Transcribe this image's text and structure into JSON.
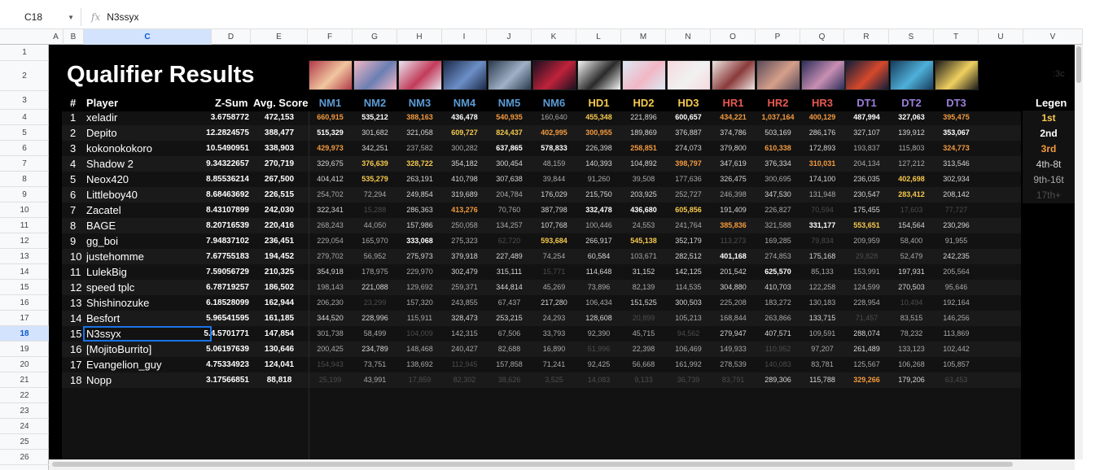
{
  "formula_bar": {
    "cell_ref": "C18",
    "fx": "fx",
    "value": "N3ssyx"
  },
  "col_headers": [
    "A",
    "B",
    "C",
    "D",
    "E",
    "F",
    "G",
    "H",
    "I",
    "J",
    "K",
    "L",
    "M",
    "N",
    "O",
    "P",
    "Q",
    "R",
    "S",
    "T",
    "U",
    "V"
  ],
  "row_numbers": [
    "1",
    "2",
    "3",
    "4",
    "5",
    "6",
    "7",
    "8",
    "9",
    "10",
    "11",
    "12",
    "13",
    "14",
    "15",
    "16",
    "17",
    "18",
    "19",
    "20",
    "21",
    "22",
    "23",
    "24",
    "25",
    "26"
  ],
  "sheet": {
    "title": "Qualifier Results",
    "rank_header": "#",
    "player_header": "Player",
    "zsum_header": "Z-Sum",
    "avg_header": "Avg. Score",
    "faded_text": ":3c",
    "legend_header": "Legen",
    "legend": [
      {
        "label": "1st",
        "color": "#f6c94e"
      },
      {
        "label": "2nd",
        "color": "#ffffff"
      },
      {
        "label": "3rd",
        "color": "#f49a3e"
      },
      {
        "label": "4th-8t",
        "color": "#d6d6d6"
      },
      {
        "label": "9th-16t",
        "color": "#a9a9a9"
      },
      {
        "label": "17th+",
        "color": "#4d4d4d"
      }
    ],
    "maps": [
      {
        "name": "NM1",
        "color": "#5b9bd5"
      },
      {
        "name": "NM2",
        "color": "#5b9bd5"
      },
      {
        "name": "NM3",
        "color": "#5b9bd5"
      },
      {
        "name": "NM4",
        "color": "#5b9bd5"
      },
      {
        "name": "NM5",
        "color": "#5b9bd5"
      },
      {
        "name": "NM6",
        "color": "#5b9bd5"
      },
      {
        "name": "HD1",
        "color": "#f6c94e"
      },
      {
        "name": "HD2",
        "color": "#f6c94e"
      },
      {
        "name": "HD3",
        "color": "#f6c94e"
      },
      {
        "name": "HR1",
        "color": "#e8584e"
      },
      {
        "name": "HR2",
        "color": "#e8584e"
      },
      {
        "name": "HR3",
        "color": "#e8584e"
      },
      {
        "name": "DT1",
        "color": "#9b7fd9"
      },
      {
        "name": "DT2",
        "color": "#9b7fd9"
      },
      {
        "name": "DT3",
        "color": "#9b7fd9"
      }
    ],
    "banner_colors": [
      [
        "#b23a48",
        "#f1c6a0"
      ],
      [
        "#f2b6c6",
        "#6b7fb3"
      ],
      [
        "#e9e4ef",
        "#c23b5a"
      ],
      [
        "#1d2a4a",
        "#6c8fc7"
      ],
      [
        "#2b3a4e",
        "#9fb1c6"
      ],
      [
        "#1a0f1f",
        "#c0223b"
      ],
      [
        "#f5f5f5",
        "#2a2a2a"
      ],
      [
        "#dbe9f5",
        "#f2b7c5"
      ],
      [
        "#f6d9de",
        "#f1f1f1"
      ],
      [
        "#efe6e2",
        "#8a3b3b"
      ],
      [
        "#5a4a5a",
        "#d6a08a"
      ],
      [
        "#2b2e5a",
        "#c98fb3"
      ],
      [
        "#0e1d3a",
        "#d6482c"
      ],
      [
        "#163b5c",
        "#4fb0d9"
      ],
      [
        "#1a1a1a",
        "#f0d060"
      ]
    ],
    "players": [
      {
        "rank": "1",
        "name": "xeladir",
        "zsum": "3.6758772",
        "avg": "472,153",
        "scores": [
          "660,915",
          "535,212",
          "388,163",
          "436,478",
          "540,935",
          "160,640",
          "455,348",
          "221,896",
          "600,657",
          "434,221",
          "1,037,164",
          "400,129",
          "487,994",
          "327,063",
          "395,475"
        ],
        "tiers": [
          3,
          2,
          3,
          2,
          3,
          5,
          1,
          4,
          2,
          3,
          3,
          3,
          2,
          2,
          3
        ]
      },
      {
        "rank": "2",
        "name": "Depito",
        "zsum": "12.2824575",
        "avg": "388,477",
        "scores": [
          "515,329",
          "301,682",
          "321,058",
          "609,727",
          "824,437",
          "402,995",
          "300,955",
          "189,869",
          "376,887",
          "374,786",
          "503,169",
          "286,176",
          "327,107",
          "139,912",
          "353,067"
        ],
        "tiers": [
          2,
          4,
          4,
          1,
          1,
          3,
          3,
          4,
          4,
          4,
          4,
          4,
          4,
          4,
          2
        ]
      },
      {
        "rank": "3",
        "name": "kokonokokoro",
        "zsum": "10.5490951",
        "avg": "338,903",
        "scores": [
          "429,973",
          "342,251",
          "237,582",
          "300,282",
          "637,865",
          "578,833",
          "226,398",
          "258,851",
          "274,073",
          "379,800",
          "610,338",
          "172,893",
          "193,837",
          "115,803",
          "324,773"
        ],
        "tiers": [
          3,
          4,
          5,
          5,
          2,
          2,
          4,
          3,
          4,
          4,
          3,
          4,
          5,
          5,
          3
        ]
      },
      {
        "rank": "4",
        "name": "Shadow 2",
        "zsum": "9.34322657",
        "avg": "270,719",
        "scores": [
          "329,675",
          "376,639",
          "328,722",
          "354,182",
          "300,454",
          "48,159",
          "140,393",
          "104,892",
          "398,797",
          "347,619",
          "376,334",
          "310,031",
          "204,134",
          "127,212",
          "313,546"
        ],
        "tiers": [
          4,
          1,
          1,
          4,
          4,
          5,
          4,
          4,
          3,
          4,
          4,
          3,
          5,
          5,
          4
        ]
      },
      {
        "rank": "5",
        "name": "Neox420",
        "zsum": "8.85536214",
        "avg": "267,500",
        "scores": [
          "404,412",
          "535,279",
          "263,191",
          "410,798",
          "307,638",
          "39,844",
          "91,260",
          "39,508",
          "177,636",
          "326,475",
          "300,695",
          "174,100",
          "236,035",
          "402,698",
          "302,934"
        ],
        "tiers": [
          4,
          1,
          4,
          4,
          4,
          5,
          5,
          5,
          5,
          4,
          5,
          4,
          4,
          1,
          4
        ]
      },
      {
        "rank": "6",
        "name": "Littleboy40",
        "zsum": "8.68463692",
        "avg": "226,515",
        "scores": [
          "254,702",
          "72,294",
          "249,854",
          "319,689",
          "204,784",
          "176,029",
          "215,750",
          "203,925",
          "252,727",
          "246,398",
          "347,530",
          "131,948",
          "230,547",
          "283,412",
          "208,142"
        ],
        "tiers": [
          5,
          5,
          4,
          4,
          5,
          4,
          4,
          4,
          5,
          5,
          4,
          5,
          4,
          1,
          4
        ]
      },
      {
        "rank": "7",
        "name": "Zacatel",
        "zsum": "8.43107899",
        "avg": "242,030",
        "scores": [
          "322,341",
          "15,288",
          "286,363",
          "413,276",
          "70,760",
          "387,798",
          "332,478",
          "436,680",
          "605,856",
          "191,409",
          "226,827",
          "70,594",
          "175,455",
          "17,603",
          "77,727"
        ],
        "tiers": [
          4,
          6,
          4,
          3,
          5,
          4,
          2,
          2,
          1,
          4,
          5,
          6,
          4,
          6,
          6
        ]
      },
      {
        "rank": "8",
        "name": "BAGE",
        "zsum": "8.20716539",
        "avg": "220,416",
        "scores": [
          "268,243",
          "44,050",
          "157,986",
          "250,058",
          "134,257",
          "107,768",
          "100,446",
          "24,553",
          "241,764",
          "385,836",
          "321,588",
          "331,177",
          "553,651",
          "154,564",
          "230,296"
        ],
        "tiers": [
          5,
          5,
          4,
          5,
          5,
          4,
          5,
          5,
          5,
          3,
          5,
          2,
          1,
          4,
          4
        ]
      },
      {
        "rank": "9",
        "name": "gg_boi",
        "zsum": "7.94837102",
        "avg": "236,451",
        "scores": [
          "229,054",
          "165,970",
          "333,068",
          "275,323",
          "62,720",
          "593,684",
          "266,917",
          "545,138",
          "352,179",
          "113,273",
          "169,285",
          "79,834",
          "209,959",
          "58,400",
          "91,955"
        ],
        "tiers": [
          5,
          5,
          2,
          5,
          6,
          1,
          4,
          1,
          4,
          6,
          5,
          6,
          5,
          5,
          5
        ]
      },
      {
        "rank": "10",
        "name": "justehomme",
        "zsum": "7.67755183",
        "avg": "194,452",
        "scores": [
          "279,702",
          "56,952",
          "275,973",
          "379,918",
          "227,489",
          "74,254",
          "60,584",
          "103,671",
          "282,512",
          "401,168",
          "274,853",
          "175,168",
          "29,828",
          "52,479",
          "242,235"
        ],
        "tiers": [
          5,
          5,
          4,
          4,
          4,
          5,
          4,
          5,
          4,
          2,
          5,
          4,
          6,
          5,
          4
        ]
      },
      {
        "rank": "11",
        "name": "LulekBig",
        "zsum": "7.59056729",
        "avg": "210,325",
        "scores": [
          "354,918",
          "178,975",
          "229,970",
          "302,479",
          "315,111",
          "15,771",
          "114,648",
          "31,152",
          "142,125",
          "201,542",
          "625,570",
          "85,133",
          "153,991",
          "197,931",
          "205,564"
        ],
        "tiers": [
          4,
          5,
          5,
          4,
          4,
          6,
          4,
          4,
          4,
          4,
          2,
          5,
          5,
          4,
          5
        ]
      },
      {
        "rank": "12",
        "name": "speed tplc",
        "zsum": "6.78719257",
        "avg": "186,502",
        "scores": [
          "198,143",
          "221,088",
          "129,692",
          "259,371",
          "344,814",
          "45,269",
          "73,896",
          "82,139",
          "114,535",
          "304,880",
          "410,703",
          "122,258",
          "124,599",
          "270,503",
          "95,646"
        ],
        "tiers": [
          5,
          4,
          5,
          5,
          4,
          5,
          5,
          5,
          5,
          4,
          4,
          5,
          5,
          4,
          5
        ]
      },
      {
        "rank": "13",
        "name": "Shishinozuke",
        "zsum": "6.18528099",
        "avg": "162,944",
        "scores": [
          "206,230",
          "23,299",
          "157,320",
          "243,855",
          "67,437",
          "217,280",
          "106,434",
          "151,525",
          "300,503",
          "225,208",
          "183,272",
          "130,183",
          "228,954",
          "10,494",
          "192,164"
        ],
        "tiers": [
          5,
          6,
          5,
          5,
          5,
          4,
          5,
          4,
          4,
          5,
          5,
          5,
          5,
          6,
          5
        ]
      },
      {
        "rank": "14",
        "name": "Besfort",
        "zsum": "5.96541595",
        "avg": "161,185",
        "scores": [
          "344,520",
          "228,996",
          "115,911",
          "328,473",
          "253,215",
          "24,293",
          "128,608",
          "20,899",
          "105,213",
          "168,844",
          "263,866",
          "133,715",
          "71,457",
          "83,515",
          "146,256"
        ],
        "tiers": [
          4,
          4,
          5,
          4,
          4,
          5,
          4,
          6,
          5,
          5,
          5,
          4,
          6,
          5,
          5
        ]
      },
      {
        "rank": "15",
        "name": "N3ssyx",
        "zsum": "5.4.5701771",
        "avg": "147,854",
        "scores": [
          "301,738",
          "58,499",
          "104,009",
          "142,315",
          "67,506",
          "33,793",
          "92,390",
          "45,715",
          "94,562",
          "279,947",
          "407,571",
          "109,591",
          "288,074",
          "78,232",
          "113,869"
        ],
        "tiers": [
          5,
          5,
          6,
          5,
          5,
          5,
          5,
          5,
          6,
          4,
          4,
          5,
          4,
          5,
          5
        ]
      },
      {
        "rank": "16",
        "name": "[MojitoBurrito]",
        "zsum": "5.06197639",
        "avg": "130,646",
        "scores": [
          "200,425",
          "234,789",
          "148,468",
          "240,427",
          "82,688",
          "16,890",
          "51,996",
          "22,398",
          "106,469",
          "149,933",
          "110,952",
          "97,207",
          "261,489",
          "133,123",
          "102,442"
        ],
        "tiers": [
          5,
          4,
          5,
          5,
          5,
          5,
          6,
          5,
          5,
          5,
          6,
          5,
          4,
          5,
          5
        ]
      },
      {
        "rank": "17",
        "name": "Evangelion_guy",
        "zsum": "4.75334923",
        "avg": "124,041",
        "scores": [
          "154,943",
          "73,751",
          "138,692",
          "112,945",
          "157,858",
          "71,241",
          "92,425",
          "56,668",
          "161,992",
          "278,539",
          "140,083",
          "83,781",
          "125,567",
          "106,268",
          "105,857"
        ],
        "tiers": [
          6,
          5,
          5,
          6,
          5,
          5,
          5,
          5,
          5,
          5,
          6,
          5,
          5,
          5,
          5
        ]
      },
      {
        "rank": "18",
        "name": "Nopp",
        "zsum": "3.17566851",
        "avg": "88,818",
        "scores": [
          "25,199",
          "43,991",
          "17,859",
          "82,302",
          "38,626",
          "3,525",
          "14,083",
          "9,133",
          "36,739",
          "83,791",
          "289,306",
          "115,788",
          "329,266",
          "179,206",
          "63,453"
        ],
        "tiers": [
          6,
          5,
          6,
          6,
          6,
          6,
          6,
          6,
          6,
          6,
          4,
          4,
          3,
          4,
          6
        ]
      }
    ]
  }
}
